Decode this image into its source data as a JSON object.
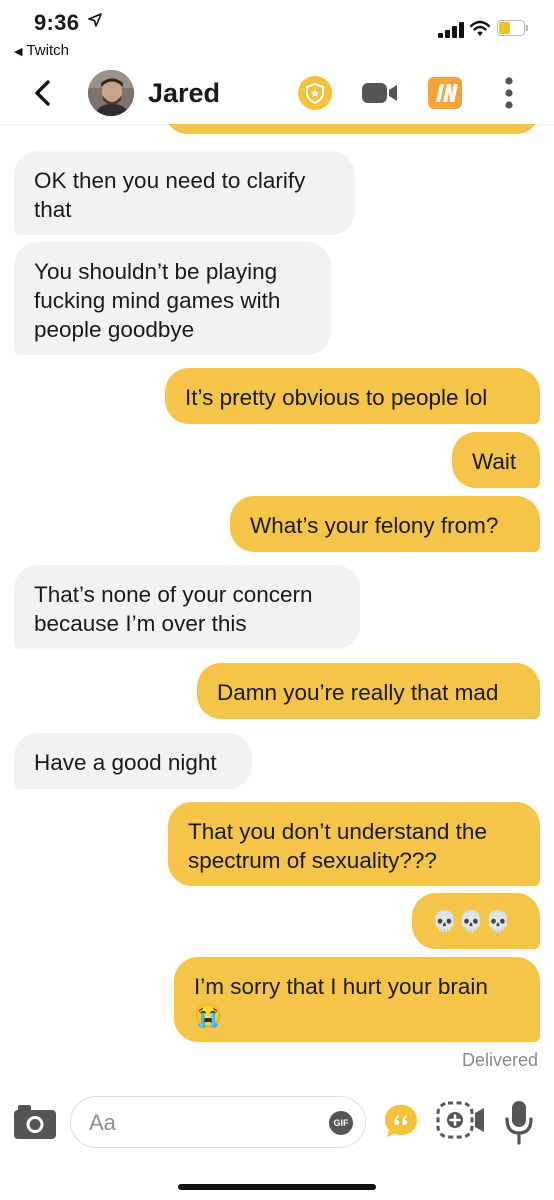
{
  "status_bar": {
    "time": "9:36",
    "back_app": "Twitch"
  },
  "header": {
    "contact_name": "Jared",
    "icons": [
      "back-chevron-icon",
      "shield-badge-icon",
      "video-camera-icon",
      "instagram-in-icon",
      "more-vertical-icon"
    ]
  },
  "messages": [
    {
      "from": "them",
      "text": "OK then you need to clarify that"
    },
    {
      "from": "them",
      "text": "You shouldn’t be playing fucking mind games with people goodbye"
    },
    {
      "from": "me",
      "text": "It’s pretty obvious to people lol"
    },
    {
      "from": "me",
      "text": "Wait"
    },
    {
      "from": "me",
      "text": "What’s your felony from?"
    },
    {
      "from": "them",
      "text": "That’s none of your concern because I’m over this"
    },
    {
      "from": "me",
      "text": "Damn you’re really that mad"
    },
    {
      "from": "them",
      "text": "Have a good night"
    },
    {
      "from": "me",
      "text": "That you don’t understand the spectrum of sexuality???"
    },
    {
      "from": "me",
      "text": "💀💀💀"
    },
    {
      "from": "me",
      "text": "I’m sorry that I hurt your brain 😭"
    }
  ],
  "delivered_label": "Delivered",
  "composer": {
    "placeholder": "Aa",
    "gif_label": "GIF"
  },
  "colors": {
    "outgoing_bubble": "#f5c54a",
    "incoming_bubble": "#f2f2f2",
    "accent": "#f5c138"
  }
}
